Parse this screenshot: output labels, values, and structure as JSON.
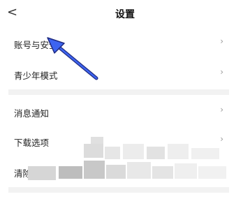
{
  "header": {
    "back_glyph": "<",
    "title": "设置"
  },
  "rows": [
    {
      "label": "账号与安全",
      "chevron": "›"
    },
    {
      "label": "青少年模式",
      "chevron": "›"
    },
    {
      "label": "消息通知",
      "chevron": "›"
    },
    {
      "label": "下载选项",
      "chevron": "›"
    },
    {
      "label": "清除",
      "chevron": ""
    }
  ],
  "colors": {
    "annotation_arrow": "#2b4fd8",
    "divider": "#f2f2f2"
  }
}
